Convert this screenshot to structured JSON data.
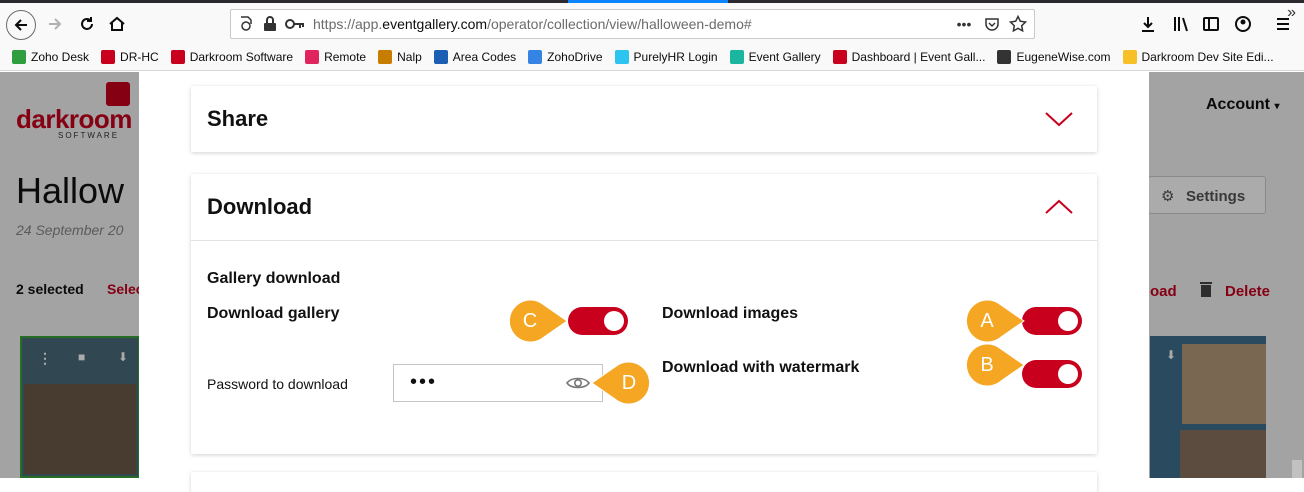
{
  "browser": {
    "url_prefix": "https://app.",
    "url_host": "eventgallery.com",
    "url_path": "/operator/collection/view/halloween-demo#",
    "page_actions": "•••"
  },
  "bookmarks": [
    {
      "label": "Zoho Desk",
      "color": "#2e9e3e"
    },
    {
      "label": "DR-HC",
      "color": "#c8001e"
    },
    {
      "label": "Darkroom Software",
      "color": "#c8001e"
    },
    {
      "label": "Remote",
      "color": "#e0245e"
    },
    {
      "label": "Nalp",
      "color": "#c77d00"
    },
    {
      "label": "Area Codes",
      "color": "#1a5fb4"
    },
    {
      "label": "ZohoDrive",
      "color": "#3584e4"
    },
    {
      "label": "PurelyHR Login",
      "color": "#2ec4f0"
    },
    {
      "label": "Event Gallery",
      "color": "#1bb6a0"
    },
    {
      "label": "Dashboard | Event Gall...",
      "color": "#c8001e"
    },
    {
      "label": "EugeneWise.com",
      "color": "#333333"
    },
    {
      "label": "Darkroom Dev Site Edi...",
      "color": "#f6c026"
    }
  ],
  "bookmarks_more": "»",
  "app": {
    "logo_text": "darkroom",
    "logo_sub": "SOFTWARE",
    "account_label": "Account",
    "page_title": "Hallow",
    "page_date": "24 September 20",
    "selected_count": "2 selected",
    "select_link": "Selec",
    "settings_label": "Settings",
    "download_link": "oad",
    "delete_link": "Delete"
  },
  "share_section": {
    "title": "Share"
  },
  "download_section": {
    "title": "Download",
    "gallery_download_heading": "Gallery download",
    "download_gallery_label": "Download gallery",
    "download_images_label": "Download images",
    "download_with_watermark_label": "Download with watermark",
    "password_label": "Password to download",
    "password_value": "•••",
    "toggle_download_gallery": true,
    "toggle_download_images": true,
    "toggle_download_watermark": true
  },
  "callouts": {
    "a": "A",
    "b": "B",
    "c": "C",
    "d": "D"
  },
  "colors": {
    "accent": "#c8001e",
    "callout": "#f5a623"
  }
}
